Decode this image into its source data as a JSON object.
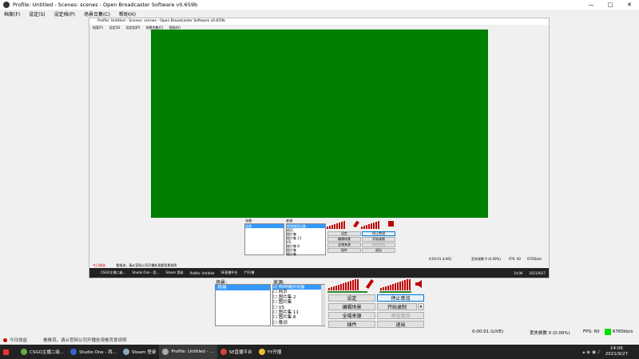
{
  "window": {
    "title": "Profile: Untitled - Scenes: scenes - Open Broadcaster Software v0.659b",
    "minimize": "—",
    "maximize": "□",
    "close": "✕"
  },
  "menu": [
    "档案(F)",
    "设定(S)",
    "设定档(P)",
    "场景合集(C)",
    "帮助(H)"
  ],
  "inner_window": {
    "title": "Profile: Untitled - Scenes: scenes - Open Broadcaster Software v0.659b",
    "menu": [
      "档案(F)",
      "设定(S)",
      "设定档(P)",
      "场景合集(C)",
      "帮助(H)"
    ],
    "scenes_label": "场景:",
    "sources_label": "来源:",
    "scene_item": "场景",
    "sources": [
      "视频捕获设备",
      "网页",
      "图片集",
      "图片集 11",
      "VS",
      "图片集 8",
      "图片集",
      "图片集",
      "图片"
    ],
    "buttons": {
      "settings": "设定",
      "stop_stream": "停止串流",
      "edit_scene": "编辑场景",
      "start_record": "开始录制",
      "global_sources": "全域来源",
      "preview": "预览串流",
      "plugins": "插件",
      "exit": "退出"
    },
    "status_time": "0:00:01 (LIVE)",
    "status_dropped": "丢失帧数 0 (0.00%)",
    "status_fps": "FPS: 60",
    "status_kbps": "6765kb/s",
    "taskbar_time": "14:06",
    "taskbar_date": "2021/9/27"
  },
  "inner_taskbar": [
    "CSGO主播二级...",
    "Studio One - 西...",
    "Steam 登录",
    "Profile: Untitled",
    "SE直播平台",
    "YY开播"
  ],
  "scenes_panel": {
    "label": "场景:",
    "items": [
      "场景"
    ]
  },
  "sources_panel": {
    "label": "来源:",
    "items": [
      {
        "name": "视频捕获设备",
        "checked": true,
        "selected": true
      },
      {
        "name": "网页",
        "checked": false,
        "selected": false
      },
      {
        "name": "图片集 2",
        "checked": false,
        "selected": false
      },
      {
        "name": "图片集",
        "checked": false,
        "selected": false
      },
      {
        "name": "VS",
        "checked": false,
        "selected": false
      },
      {
        "name": "图片集 11",
        "checked": false,
        "selected": false
      },
      {
        "name": "图片集 8",
        "checked": false,
        "selected": false
      },
      {
        "name": "歌词",
        "checked": false,
        "selected": false
      }
    ]
  },
  "buttons": {
    "settings": "设定",
    "stop_stream": "停止串流",
    "edit_scene": "编辑场景",
    "start_record": "开始录制",
    "global_sources": "全域来源",
    "preview": "预览串流",
    "plugins": "插件",
    "exit": "退出"
  },
  "status": {
    "notice": "今日收益",
    "message": "看推流，请从官网公司开播处观看背景说明",
    "time": "0:00:01 (LIVE)",
    "dropped": "丢失帧数 0 (0.00%)",
    "fps": "FPS: 60",
    "kbps": "6765kb/s"
  },
  "taskbar": {
    "tasks": [
      "CSGO主播二级...",
      "Studio One - 西...",
      "Steam 登录",
      "Profile: Untitled - ...",
      "SE直播平台",
      "YY开播"
    ],
    "time": "14:06",
    "date": "2021/9/27"
  },
  "colors": {
    "preview": "#008000",
    "selection": "#3399ff",
    "meter": "#c00000",
    "fps_indicator": "#00e000"
  }
}
